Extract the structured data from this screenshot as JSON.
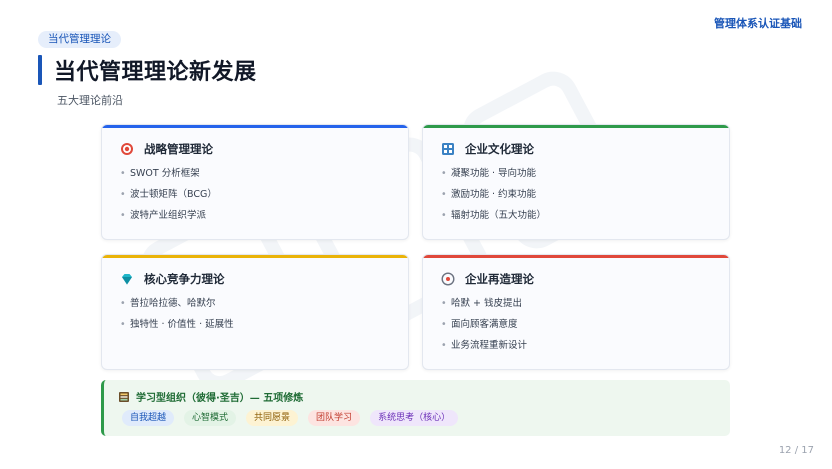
{
  "header": {
    "top_right": "管理体系认证基础",
    "section_pill": "当代管理理论",
    "title": "当代管理理论新发展",
    "subtitle": "五大理论前沿"
  },
  "cards": [
    {
      "title": "战略管理理论",
      "icon": "target-icon",
      "accent": "#2563eb",
      "items": [
        "SWOT 分析框架",
        "波士顿矩阵（BCG）",
        "波特产业组织学派"
      ]
    },
    {
      "title": "企业文化理论",
      "icon": "building-icon",
      "accent": "#2e9a4a",
      "items": [
        "凝聚功能 · 导向功能",
        "激励功能 · 约束功能",
        "辐射功能（五大功能）"
      ]
    },
    {
      "title": "核心竞争力理论",
      "icon": "gem-icon",
      "accent": "#eab308",
      "items": [
        "普拉哈拉德、哈默尔",
        "独特性 · 价值性 · 延展性"
      ]
    },
    {
      "title": "企业再造理论",
      "icon": "cycle-icon",
      "accent": "#e0483a",
      "items": [
        "哈默 + 钱皮提出",
        "面向顾客满意度",
        "业务流程重新设计"
      ]
    }
  ],
  "learning_org": {
    "title": "学习型组织（彼得·圣吉）— 五项修炼",
    "icon": "book-icon",
    "tags": [
      {
        "label": "自我超越",
        "bg": "#e0ebfb",
        "fg": "#1a56b8"
      },
      {
        "label": "心智模式",
        "bg": "#e3f3e6",
        "fg": "#1e6b34"
      },
      {
        "label": "共同愿景",
        "bg": "#fdf3d3",
        "fg": "#8a5a00"
      },
      {
        "label": "团队学习",
        "bg": "#fde4e1",
        "fg": "#c0392b"
      },
      {
        "label": "系统思考（核心）",
        "bg": "#efe6fb",
        "fg": "#6b2fb8"
      }
    ]
  },
  "footer": {
    "page": "12 / 17"
  }
}
